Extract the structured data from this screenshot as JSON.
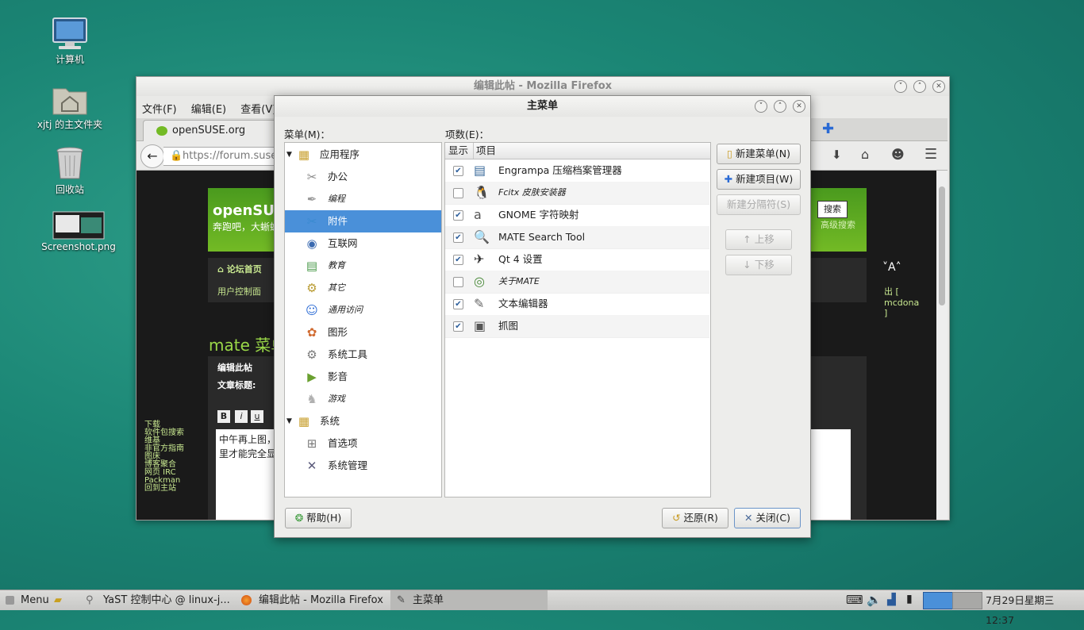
{
  "desktop": {
    "icons": [
      {
        "label": "计算机",
        "icon": "computer-icon"
      },
      {
        "label": "xjtj 的主文件夹",
        "icon": "home-folder-icon"
      },
      {
        "label": "回收站",
        "icon": "trash-icon"
      },
      {
        "label": "Screenshot.png",
        "icon": "image-file-icon"
      }
    ]
  },
  "firefox": {
    "title": "编辑此帖 - Mozilla Firefox",
    "menus": [
      "文件(F)",
      "编辑(E)",
      "查看(V)"
    ],
    "tab_label": "openSUSE.org",
    "url": "https://forum.suse",
    "page": {
      "site_name": "openSUS",
      "tagline": "奔跑吧，大蜥蜴",
      "search_button": "搜索",
      "advanced_search": "高级搜索",
      "breadcrumb_home": "论坛首页",
      "user_panel": "用户控制面",
      "user_info": "出 [ mcdona ]",
      "font_size_ctrl": "˅A˄",
      "post_title": "mate 菜单",
      "edit_header": "编辑此帖",
      "subject_label": "文章标题:",
      "format_buttons": [
        "B",
        "i",
        "u"
      ],
      "body_text_1": "中午再上图，",
      "body_text_2": "里才能完全显",
      "side_links": [
        "下载",
        "软件包搜索",
        "维基",
        "非官方指南",
        "图床",
        "博客聚合",
        "网页 IRC",
        "Packman",
        "回到主站"
      ]
    }
  },
  "dialog": {
    "title": "主菜单",
    "menu_label": "菜单(M)：",
    "items_label": "项数(E)：",
    "columns": [
      "显示",
      "项目"
    ],
    "tree": [
      {
        "label": "应用程序",
        "level": 0,
        "expanded": true,
        "italic": false,
        "icon": "applications-icon"
      },
      {
        "label": "办公",
        "level": 1,
        "italic": false,
        "icon": "office-icon"
      },
      {
        "label": "编程",
        "level": 1,
        "italic": true,
        "icon": "programming-icon"
      },
      {
        "label": "附件",
        "level": 1,
        "italic": false,
        "selected": true,
        "icon": "accessories-icon"
      },
      {
        "label": "互联网",
        "level": 1,
        "italic": false,
        "icon": "internet-icon"
      },
      {
        "label": "教育",
        "level": 1,
        "italic": true,
        "icon": "education-icon"
      },
      {
        "label": "其它",
        "level": 1,
        "italic": true,
        "icon": "other-icon"
      },
      {
        "label": "通用访问",
        "level": 1,
        "italic": true,
        "icon": "accessibility-icon"
      },
      {
        "label": "图形",
        "level": 1,
        "italic": false,
        "icon": "graphics-icon"
      },
      {
        "label": "系统工具",
        "level": 1,
        "italic": false,
        "icon": "system-tools-icon"
      },
      {
        "label": "影音",
        "level": 1,
        "italic": false,
        "icon": "multimedia-icon"
      },
      {
        "label": "游戏",
        "level": 1,
        "italic": true,
        "icon": "games-icon"
      },
      {
        "label": "系统",
        "level": 0,
        "expanded": true,
        "italic": false,
        "icon": "system-icon"
      },
      {
        "label": "首选项",
        "level": 1,
        "italic": false,
        "icon": "preferences-icon"
      },
      {
        "label": "系统管理",
        "level": 1,
        "italic": false,
        "icon": "administration-icon"
      }
    ],
    "items": [
      {
        "label": "Engrampa 压缩档案管理器",
        "checked": true,
        "italic": false,
        "icon": "archive-icon"
      },
      {
        "label": "Fcitx 皮肤安装器",
        "checked": false,
        "italic": true,
        "icon": "tux-icon"
      },
      {
        "label": "GNOME 字符映射",
        "checked": true,
        "italic": false,
        "icon": "charmap-icon"
      },
      {
        "label": "MATE Search Tool",
        "checked": true,
        "italic": false,
        "icon": "search-icon"
      },
      {
        "label": "Qt 4 设置",
        "checked": true,
        "italic": false,
        "icon": "qt-settings-icon"
      },
      {
        "label": "关于MATE",
        "checked": false,
        "italic": true,
        "icon": "mate-logo-icon"
      },
      {
        "label": "文本编辑器",
        "checked": true,
        "italic": false,
        "icon": "text-editor-icon"
      },
      {
        "label": "抓图",
        "checked": true,
        "italic": false,
        "icon": "screenshot-icon"
      }
    ],
    "buttons": {
      "new_menu": "新建菜单(N)",
      "new_item": "新建项目(W)",
      "new_separator": "新建分隔符(S)",
      "move_up": "上移",
      "move_down": "下移",
      "help": "帮助(H)",
      "revert": "还原(R)",
      "close": "关闭(C)"
    }
  },
  "taskbar": {
    "menu_label": "Menu",
    "tasks": [
      {
        "label": "YaST 控制中心 @ linux-j...",
        "active": false
      },
      {
        "label": "编辑此帖 - Mozilla Firefox",
        "active": false
      },
      {
        "label": "主菜单",
        "active": true
      }
    ],
    "clock": "7月29日星期三 12:37"
  },
  "colors": {
    "selection": "#4a90d9",
    "forum_green": "#73ba25",
    "page_dark": "#1a1a1a"
  }
}
